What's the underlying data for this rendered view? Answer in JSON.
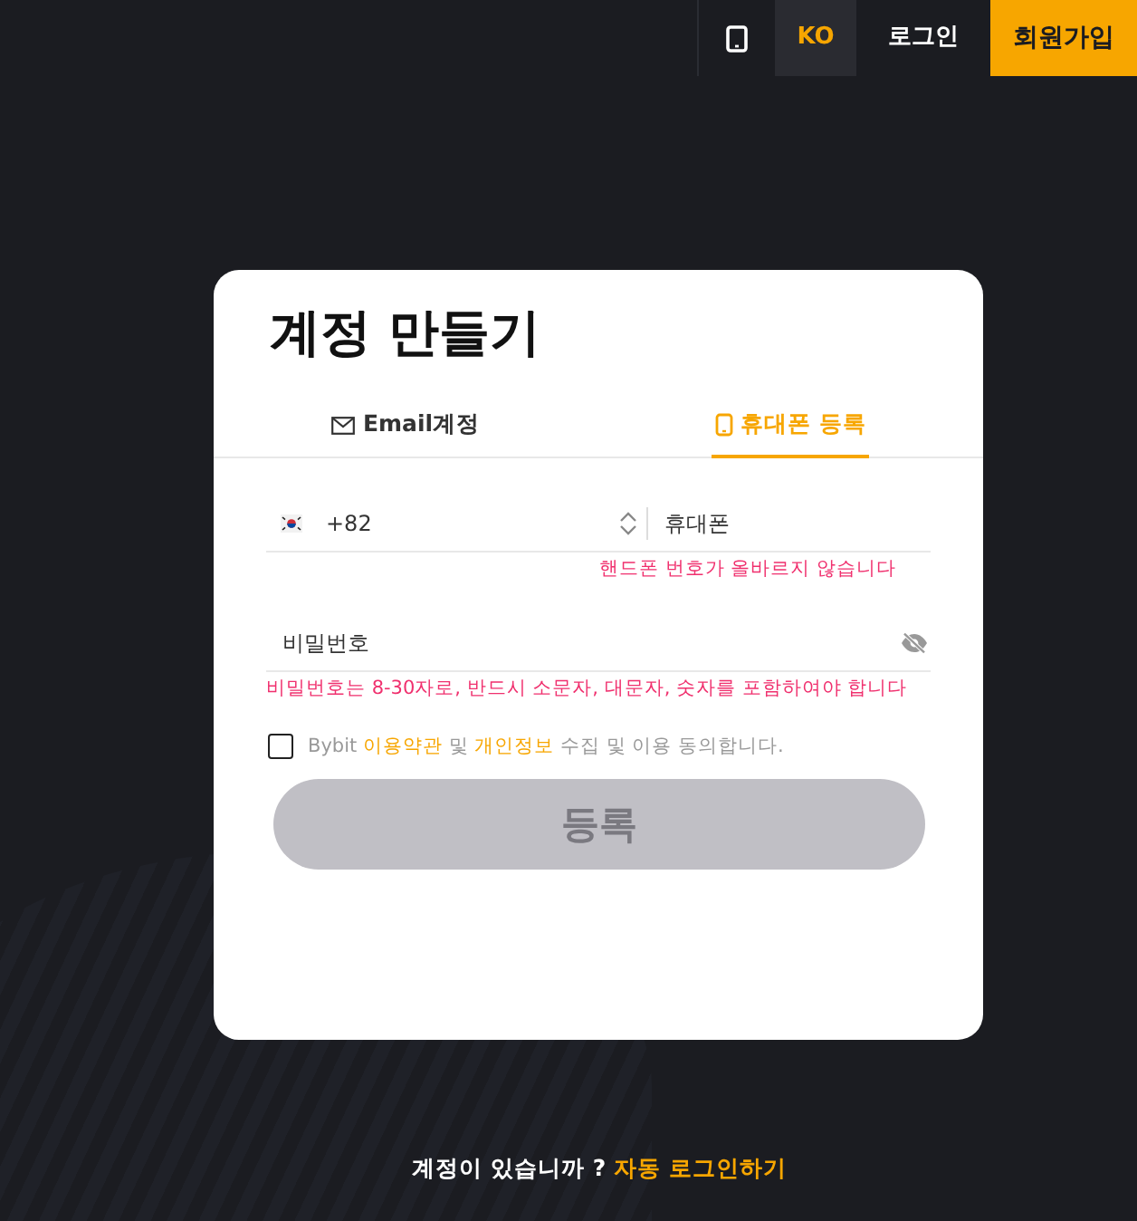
{
  "header": {
    "items": [
      {
        "kind": "icon"
      },
      {
        "kind": "lang",
        "label": "KO"
      },
      {
        "kind": "link",
        "label": "로그인"
      },
      {
        "kind": "primary",
        "label": "회원가입"
      }
    ]
  },
  "card": {
    "title": "계정 만들기",
    "tabs": [
      {
        "label": "Email계정",
        "kind": "email",
        "selected": false
      },
      {
        "label": "휴대폰 등록",
        "kind": "phone",
        "selected": true
      }
    ],
    "phone": {
      "country_code": "+82",
      "placeholder": "휴대폰",
      "error": "핸드폰 번호가 올바르지 않습니다"
    },
    "password": {
      "placeholder": "비밀번호",
      "error": "비밀번호는 8-30자로, 반드시 소문자, 대문자, 숫자를 포함하여야 합니다"
    },
    "agreement": {
      "checked": false,
      "parts": [
        {
          "kind": "text",
          "text": "Bybit "
        },
        {
          "kind": "link",
          "text": "이용약관"
        },
        {
          "kind": "text",
          "text": " 및 "
        },
        {
          "kind": "link",
          "text": "개인정보"
        },
        {
          "kind": "text",
          "text": " 수집 및 이용 동의합니다."
        }
      ]
    },
    "submit": {
      "label": "등록",
      "disabled": true
    }
  },
  "footer": {
    "text": "계정이 있습니까 ?",
    "link": "자동 로그인하기"
  }
}
